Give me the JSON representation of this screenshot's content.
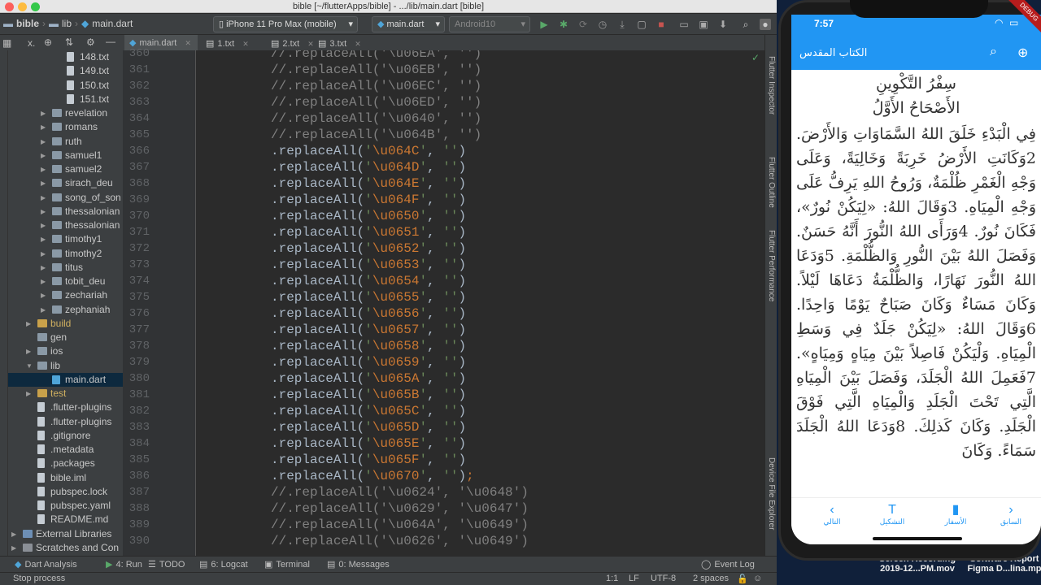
{
  "window": {
    "title": "bible [~/flutterApps/bible] - .../lib/main.dart [bible]"
  },
  "toolbar": {
    "breadcrumbs": [
      "bible",
      "lib",
      "main.dart"
    ],
    "device": "iPhone 11 Pro Max (mobile)",
    "config": "main.dart",
    "emulator": "Android10"
  },
  "tabs": [
    {
      "label": "main.dart"
    },
    {
      "label": "1.txt"
    },
    {
      "label": "2.txt"
    },
    {
      "label": "3.txt"
    }
  ],
  "tree": [
    {
      "label": "148.txt",
      "indent": 3,
      "type": "file"
    },
    {
      "label": "149.txt",
      "indent": 3,
      "type": "file"
    },
    {
      "label": "150.txt",
      "indent": 3,
      "type": "file"
    },
    {
      "label": "151.txt",
      "indent": 3,
      "type": "file"
    },
    {
      "label": "revelation",
      "indent": 2,
      "type": "folder"
    },
    {
      "label": "romans",
      "indent": 2,
      "type": "folder"
    },
    {
      "label": "ruth",
      "indent": 2,
      "type": "folder"
    },
    {
      "label": "samuel1",
      "indent": 2,
      "type": "folder"
    },
    {
      "label": "samuel2",
      "indent": 2,
      "type": "folder"
    },
    {
      "label": "sirach_deu",
      "indent": 2,
      "type": "folder"
    },
    {
      "label": "song_of_son",
      "indent": 2,
      "type": "folder"
    },
    {
      "label": "thessalonian",
      "indent": 2,
      "type": "folder"
    },
    {
      "label": "thessalonian",
      "indent": 2,
      "type": "folder"
    },
    {
      "label": "timothy1",
      "indent": 2,
      "type": "folder"
    },
    {
      "label": "timothy2",
      "indent": 2,
      "type": "folder"
    },
    {
      "label": "titus",
      "indent": 2,
      "type": "folder"
    },
    {
      "label": "tobit_deu",
      "indent": 2,
      "type": "folder"
    },
    {
      "label": "zechariah",
      "indent": 2,
      "type": "folder"
    },
    {
      "label": "zephaniah",
      "indent": 2,
      "type": "folder"
    },
    {
      "label": "build",
      "indent": 1,
      "type": "folder-build"
    },
    {
      "label": "gen",
      "indent": 1,
      "type": "folder-noarrow"
    },
    {
      "label": "ios",
      "indent": 1,
      "type": "folder"
    },
    {
      "label": "lib",
      "indent": 1,
      "type": "folder-open"
    },
    {
      "label": "main.dart",
      "indent": 2,
      "type": "dart",
      "selected": true
    },
    {
      "label": "test",
      "indent": 1,
      "type": "folder-build"
    },
    {
      "label": ".flutter-plugins",
      "indent": 1,
      "type": "file"
    },
    {
      "label": ".flutter-plugins",
      "indent": 1,
      "type": "file"
    },
    {
      "label": ".gitignore",
      "indent": 1,
      "type": "file"
    },
    {
      "label": ".metadata",
      "indent": 1,
      "type": "file"
    },
    {
      "label": ".packages",
      "indent": 1,
      "type": "file"
    },
    {
      "label": "bible.iml",
      "indent": 1,
      "type": "file"
    },
    {
      "label": "pubspec.lock",
      "indent": 1,
      "type": "file"
    },
    {
      "label": "pubspec.yaml",
      "indent": 1,
      "type": "file"
    },
    {
      "label": "README.md",
      "indent": 1,
      "type": "file"
    },
    {
      "label": "External Libraries",
      "indent": 0,
      "type": "lib"
    },
    {
      "label": "Scratches and Con",
      "indent": 0,
      "type": "scratch"
    }
  ],
  "code": [
    {
      "n": "360",
      "text": "//.replaceAll('\\u06EA', '')",
      "kind": "comment"
    },
    {
      "n": "361",
      "text": "//.replaceAll('\\u06EB', '')",
      "kind": "comment"
    },
    {
      "n": "362",
      "text": "//.replaceAll('\\u06EC', '')",
      "kind": "comment"
    },
    {
      "n": "363",
      "text": "//.replaceAll('\\u06ED', '')",
      "kind": "comment"
    },
    {
      "n": "364",
      "text": "//.replaceAll('\\u0640', '')",
      "kind": "comment"
    },
    {
      "n": "365",
      "text": "//.replaceAll('\\u064B', '')",
      "kind": "comment"
    },
    {
      "n": "366",
      "esc": "\\u064C",
      "kind": "code"
    },
    {
      "n": "367",
      "esc": "\\u064D",
      "kind": "code"
    },
    {
      "n": "368",
      "esc": "\\u064E",
      "kind": "code"
    },
    {
      "n": "369",
      "esc": "\\u064F",
      "kind": "code"
    },
    {
      "n": "370",
      "esc": "\\u0650",
      "kind": "code"
    },
    {
      "n": "371",
      "esc": "\\u0651",
      "kind": "code"
    },
    {
      "n": "372",
      "esc": "\\u0652",
      "kind": "code"
    },
    {
      "n": "373",
      "esc": "\\u0653",
      "kind": "code"
    },
    {
      "n": "374",
      "esc": "\\u0654",
      "kind": "code"
    },
    {
      "n": "375",
      "esc": "\\u0655",
      "kind": "code"
    },
    {
      "n": "376",
      "esc": "\\u0656",
      "kind": "code"
    },
    {
      "n": "377",
      "esc": "\\u0657",
      "kind": "code"
    },
    {
      "n": "378",
      "esc": "\\u0658",
      "kind": "code"
    },
    {
      "n": "379",
      "esc": "\\u0659",
      "kind": "code"
    },
    {
      "n": "380",
      "esc": "\\u065A",
      "kind": "code"
    },
    {
      "n": "381",
      "esc": "\\u065B",
      "kind": "code"
    },
    {
      "n": "382",
      "esc": "\\u065C",
      "kind": "code"
    },
    {
      "n": "383",
      "esc": "\\u065D",
      "kind": "code"
    },
    {
      "n": "384",
      "esc": "\\u065E",
      "kind": "code"
    },
    {
      "n": "385",
      "esc": "\\u065F",
      "kind": "code"
    },
    {
      "n": "386",
      "esc": "\\u0670",
      "kind": "code",
      "end": ";"
    },
    {
      "n": "387",
      "text": "//.replaceAll('\\u0624', '\\u0648')",
      "kind": "comment"
    },
    {
      "n": "388",
      "text": "//.replaceAll('\\u0629', '\\u0647')",
      "kind": "comment"
    },
    {
      "n": "389",
      "text": "//.replaceAll('\\u064A', '\\u0649')",
      "kind": "comment"
    },
    {
      "n": "390",
      "text": "//.replaceAll('\\u0626', '\\u0649')",
      "kind": "comment"
    }
  ],
  "right_tools": [
    "Flutter Inspector",
    "Flutter Outline",
    "Flutter Performance",
    "Device File Explorer"
  ],
  "bottom_tools": [
    {
      "label": "Dart Analysis"
    },
    {
      "label": "4: Run"
    },
    {
      "label": "TODO"
    },
    {
      "label": "6: Logcat"
    },
    {
      "label": "Terminal"
    },
    {
      "label": "0: Messages"
    },
    {
      "label": "Event Log"
    }
  ],
  "status": {
    "message": "Stop process",
    "position": "1:1",
    "line_sep": "LF",
    "encoding": "UTF-8",
    "indent": "2 spaces"
  },
  "phone": {
    "time": "7:57",
    "app_title": "الكتاب المقدس",
    "debug_banner": "DEBUG",
    "book_title": "سِفْرُ التَّكْوِينِ",
    "chapter_title": "الأَصْحَاحُ الأَوَّلُ",
    "text": "فِي الْبَدْءِ خَلَقَ اللهُ السَّمَاوَاتِ وَالأَرْضَ. 2وَكَانَتِ الأَرْضُ خَرِبَةً وَخَالِيَةً، وَعَلَى وَجْهِ الْغَمْرِ ظُلْمَةٌ، وَرُوحُ اللهِ يَرِفُّ عَلَى وَجْهِ الْمِيَاهِ. 3وَقَالَ اللهُ: «لِيَكُنْ نُورٌ»، فَكَانَ نُورٌ. 4وَرَأَى اللهُ النُّورَ أَنَّهُ حَسَنٌ. وَفَصَلَ اللهُ بَيْنَ النُّورِ وَالظُّلْمَةِ. 5وَدَعَا اللهُ النُّورَ نَهَارًا، وَالظُّلْمَةُ دَعَاهَا لَيْلاً. وَكَانَ مَسَاءٌ وَكَانَ صَبَاحٌ يَوْمًا وَاحِدًا. 6وَقَالَ اللهُ: «لِيَكُنْ جَلَدٌ فِي وَسَطِ الْمِيَاهِ. وَلْيَكُنْ فَاصِلاً بَيْنَ مِيَاهٍ وَمِيَاهٍ». 7فَعَمِلَ اللهُ الْجَلَدَ، وَفَصَلَ بَيْنَ الْمِيَاهِ الَّتِي تَحْتَ الْجَلَدِ وَالْمِيَاهِ الَّتِي فَوْقَ الْجَلَدِ. وَكَانَ كَذلِكَ. 8وَدَعَا اللهُ الْجَلَدَ سَمَاءً. وَكَانَ",
    "nav": [
      {
        "label": "التالي",
        "icon": "chevron-left"
      },
      {
        "label": "التشكيل",
        "icon": "format"
      },
      {
        "label": "الأسفار",
        "icon": "book"
      },
      {
        "label": "السابق",
        "icon": "chevron-right"
      }
    ]
  },
  "desktop": [
    {
      "label": "Screen Recording 2019-12...PM.mov"
    },
    {
      "label": "Software Report Figma D...lina.mp"
    }
  ]
}
